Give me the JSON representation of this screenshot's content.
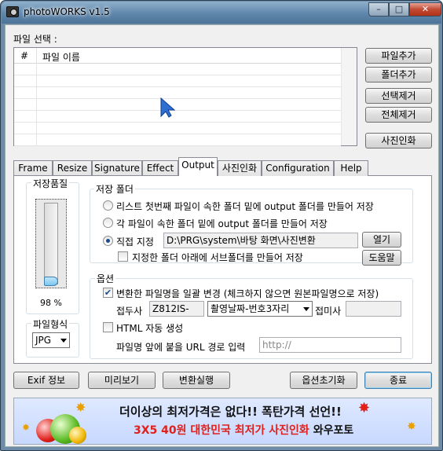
{
  "window": {
    "title": "photoWORKS v1.5",
    "minimize": "–",
    "maximize": "□",
    "close": "✕"
  },
  "file_select": {
    "label": "파일 선택 :",
    "columns": [
      "#",
      "파일 이름"
    ],
    "row_count": 7
  },
  "right_buttons": {
    "add_file": "파일추가",
    "add_folder": "폴더추가",
    "remove_selected": "선택제거",
    "remove_all": "전체제거",
    "photo_print": "사진인화"
  },
  "tabs": [
    "Frame",
    "Resize",
    "Signature",
    "Effect",
    "Output",
    "사진인화",
    "Configuration",
    "Help"
  ],
  "active_tab": "Output",
  "quality": {
    "title": "저장품질",
    "value_label": "98 %",
    "value": 98
  },
  "file_format": {
    "title": "파일형식",
    "selected": "JPG"
  },
  "save_folder": {
    "title": "저장 폴더",
    "option1": "리스트 첫번째 파일이 속한 폴더 밑에 output  폴더를 만들어 저장",
    "option2": "각 파일이 속한 폴더 밑에 output  폴더를 만들어 저장",
    "option3": "직접 지정",
    "selected": "option3",
    "path": "D:\\PRG\\system\\바탕 화면\\사진변환",
    "open_button": "열기",
    "subfolder_check": "지정한 폴더 아래에 서브폴더를 만들어 저장",
    "help_button": "도움말"
  },
  "options": {
    "title": "옵션",
    "rename_check": "변환한 파일명을 일괄 변경 (체크하지 않으면 원본파일명으로 저장)",
    "rename_checked": true,
    "prefix_label": "접두사",
    "prefix_value": "Z812IS-",
    "rename_pattern": "촬영날짜-번호3자리",
    "suffix_label": "접미사",
    "suffix_value": "",
    "html_check": "HTML 자동 생성",
    "html_checked": false,
    "url_label": "파일명 앞에 붙을 URL 경로 입력",
    "url_placeholder": "http://"
  },
  "bottom_buttons": {
    "exif": "Exif 정보",
    "preview": "미리보기",
    "convert": "변환실행",
    "reset_options": "옵션초기화",
    "exit": "종료"
  },
  "banner": {
    "line1": "더이상의 최저가격은 없다!! 폭탄가격 선언!!",
    "line2_red": "3X5 40원 대한민국 최저가 사진인화",
    "line2_brand": "와우포토"
  },
  "colors": {
    "accent": "#3c7fb1",
    "banner_red": "#e0201a"
  }
}
